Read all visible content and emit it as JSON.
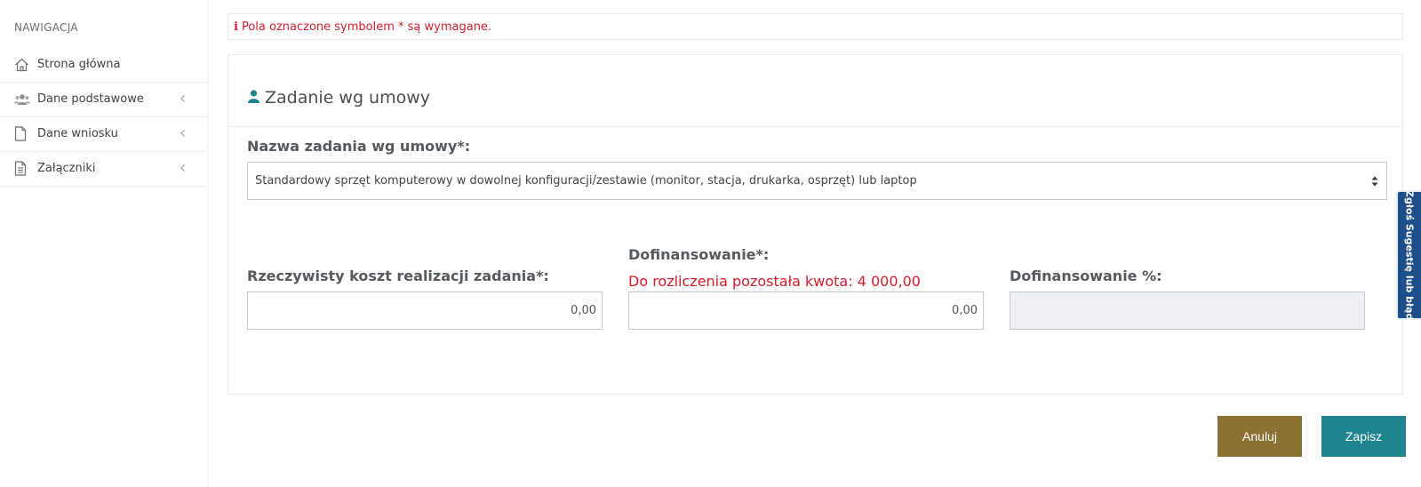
{
  "sidebar": {
    "heading": "NAWIGACJA",
    "items": [
      {
        "label": "Strona główna",
        "icon": "home-icon"
      },
      {
        "label": "Dane podstawowe",
        "icon": "users-icon"
      },
      {
        "label": "Dane wniosku",
        "icon": "file-icon"
      },
      {
        "label": "Załączniki",
        "icon": "file-text-icon"
      }
    ]
  },
  "alert": {
    "text": "Pola oznaczone symbolem * są wymagane."
  },
  "panel": {
    "title": "Zadanie wg umowy",
    "task_label": "Nazwa zadania wg umowy*:",
    "task_value": "Standardowy sprzęt komputerowy w dowolnej konfiguracji/zestawie (monitor, stacja, drukarka, osprzęt) lub laptop",
    "cost_label": "Rzeczywisty koszt realizacji zadania*:",
    "cost_value": "0,00",
    "funding_label": "Dofinansowanie*:",
    "funding_warning": "Do rozliczenia pozostała kwota: 4 000,00",
    "funding_value": "0,00",
    "funding_pct_label": "Dofinansowanie %:",
    "funding_pct_value": ""
  },
  "buttons": {
    "cancel": "Anuluj",
    "save": "Zapisz"
  },
  "feedback_tab": {
    "label": "Zgłoś Sugestię lub błąd"
  },
  "colors": {
    "required_red": "#d51d2c",
    "cancel_button": "#8d7033",
    "save_button": "#1f8390",
    "feedback_tab": "#1e4e8a",
    "user_icon": "#1f8390"
  }
}
